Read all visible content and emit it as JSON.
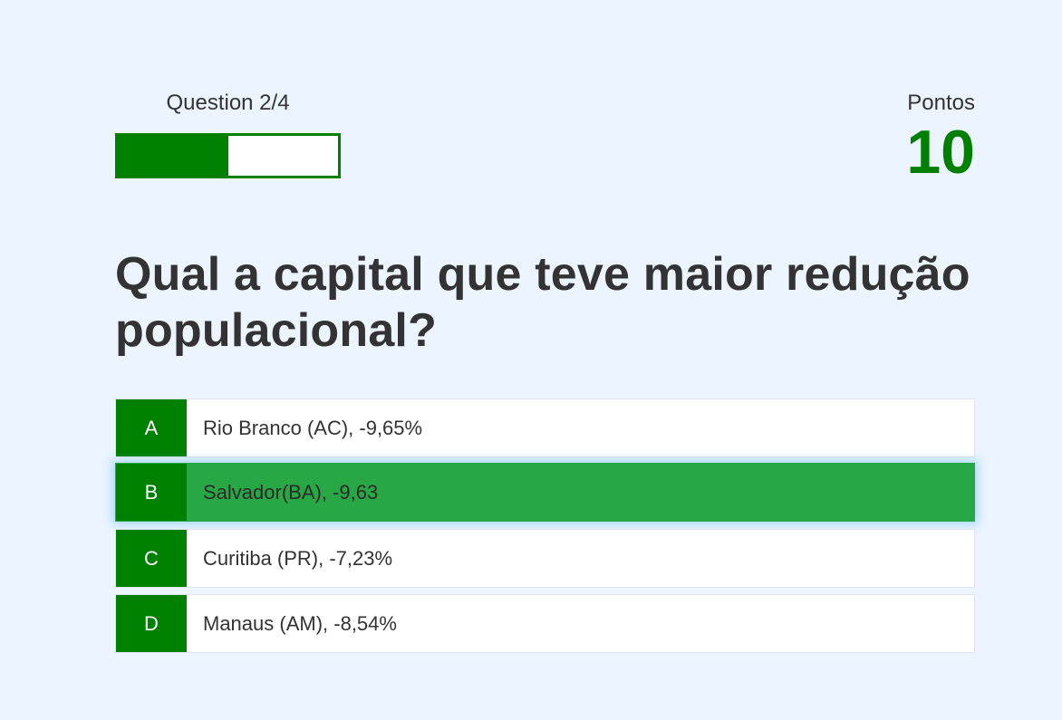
{
  "hud": {
    "progress_text": "Question 2/4",
    "progress_fraction": 0.5,
    "score_label": "Pontos",
    "score_value": "10"
  },
  "question": {
    "text": "Qual a capital que teve maior redução populacional?"
  },
  "choices": [
    {
      "prefix": "A",
      "text": "Rio Branco (AC), -9,65%",
      "selected": false
    },
    {
      "prefix": "B",
      "text": "Salvador(BA), -9,63",
      "selected": true
    },
    {
      "prefix": "C",
      "text": "Curitiba (PR), -7,23%",
      "selected": false
    },
    {
      "prefix": "D",
      "text": "Manaus (AM), -8,54%",
      "selected": false
    }
  ],
  "colors": {
    "accent": "#008000",
    "selected": "#28a745",
    "background": "#ebf4ff"
  }
}
